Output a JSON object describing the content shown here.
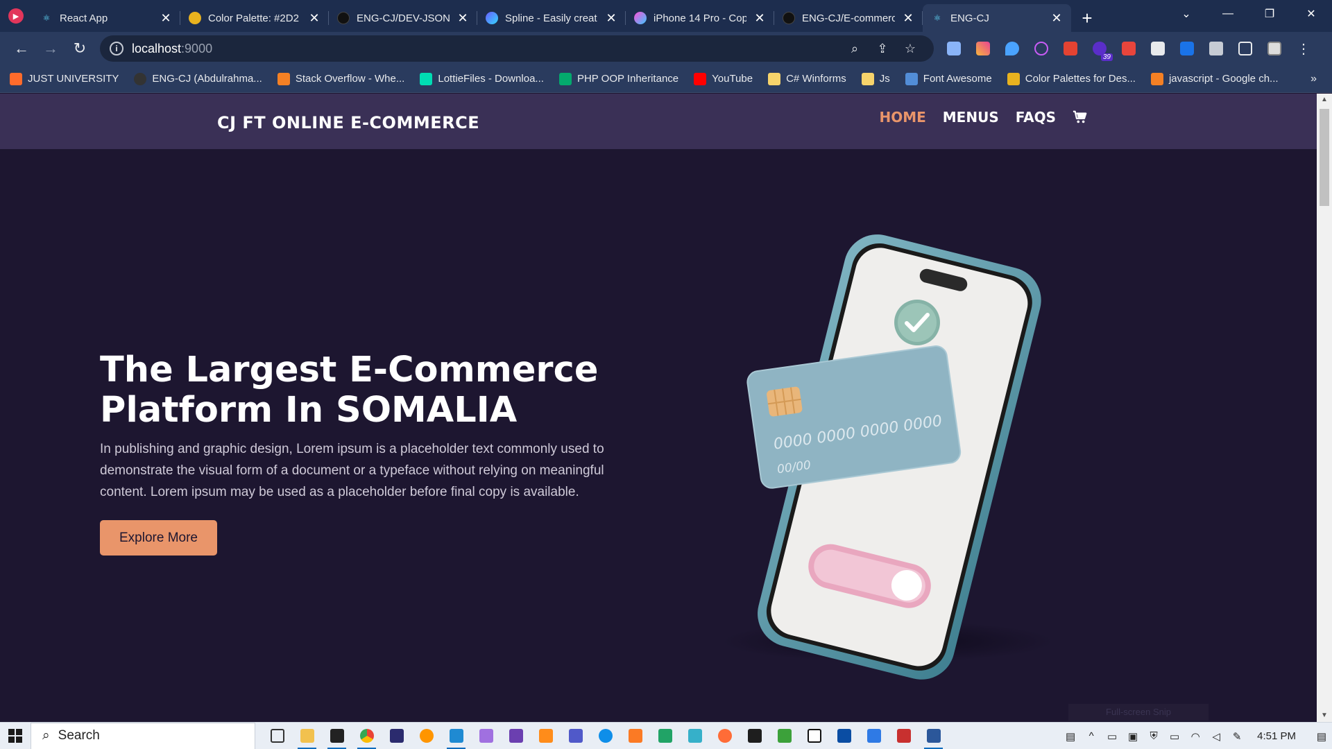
{
  "browser": {
    "tabs": [
      {
        "label": "React App",
        "active": false
      },
      {
        "label": "Color Palette: #2D2",
        "active": false
      },
      {
        "label": "ENG-CJ/DEV-JSON-",
        "active": false
      },
      {
        "label": "Spline - Easily creat",
        "active": false
      },
      {
        "label": "iPhone 14 Pro - Cop",
        "active": false
      },
      {
        "label": "ENG-CJ/E-commerc",
        "active": false
      },
      {
        "label": "ENG-CJ",
        "active": true
      }
    ],
    "url_host": "localhost",
    "url_port": ":9000",
    "extension_badge": "39",
    "bookmarks": [
      {
        "label": "JUST UNIVERSITY",
        "color": "#ff6b2b"
      },
      {
        "label": "ENG-CJ (Abdulrahma...",
        "color": "#333333"
      },
      {
        "label": "Stack Overflow - Whe...",
        "color": "#f48024"
      },
      {
        "label": "LottieFiles - Downloa...",
        "color": "#00ddb3"
      },
      {
        "label": "PHP OOP Inheritance",
        "color": "#04aa6d"
      },
      {
        "label": "YouTube",
        "color": "#ff0000"
      },
      {
        "label": "C# Winforms",
        "color": "#f6d36b"
      },
      {
        "label": "Js",
        "color": "#f6d36b"
      },
      {
        "label": "Font Awesome",
        "color": "#528dd7"
      },
      {
        "label": "Color Palettes for Des...",
        "color": "#e8b21f"
      },
      {
        "label": "javascript - Google ch...",
        "color": "#f48024"
      }
    ]
  },
  "site": {
    "brand": "CJ FT ONLINE E-COMMERCE",
    "nav": [
      {
        "label": "HOME",
        "current": true
      },
      {
        "label": "MENUS",
        "current": false
      },
      {
        "label": "FAQS",
        "current": false
      }
    ],
    "hero": {
      "title": "The Largest E-Commerce Platform In SOMALIA",
      "text": "In publishing and graphic design, Lorem ipsum is a placeholder text commonly used to demonstrate the visual form of a document or a typeface without relying on meaningful content. Lorem ipsum may be used as a placeholder before final copy is available.",
      "button": "Explore More"
    },
    "card": {
      "number": "0000 0000 0000 0000",
      "expiry": "00/00"
    },
    "colors": {
      "background": "#1d1630",
      "header": "#3a3056",
      "accent": "#e9956a"
    }
  },
  "overlay": {
    "snip_label": "Full-screen Snip"
  },
  "taskbar": {
    "search_label": "Search",
    "time": "4:51 PM"
  }
}
